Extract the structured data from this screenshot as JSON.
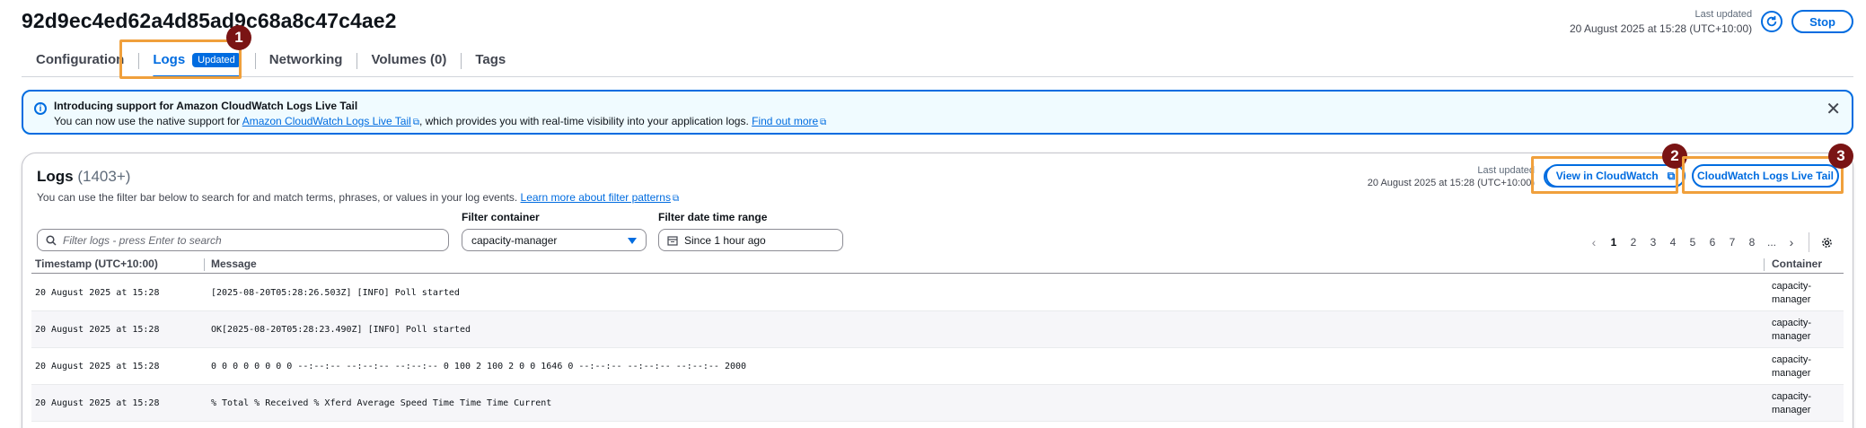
{
  "header": {
    "task_id": "92d9ec4ed62a4d85ad9c68a8c47c4ae2",
    "last_updated_label": "Last updated",
    "last_updated_value": "20 August 2025 at 15:28 (UTC+10:00)",
    "stop_label": "Stop"
  },
  "tabs": [
    {
      "label": "Configuration"
    },
    {
      "label": "Logs",
      "badge": "Updated"
    },
    {
      "label": "Networking"
    },
    {
      "label": "Volumes (0)"
    },
    {
      "label": "Tags"
    }
  ],
  "banner": {
    "title": "Introducing support for Amazon CloudWatch Logs Live Tail",
    "text_before": "You can now use the native support for ",
    "link1": "Amazon CloudWatch Logs Live Tail",
    "text_middle": ", which provides you with real-time visibility into your application logs. ",
    "link2": "Find out more"
  },
  "logs": {
    "title": "Logs",
    "count": "(1403+)",
    "description": "You can use the filter bar below to search for and match terms, phrases, or values in your log events. ",
    "learn_more": "Learn more about filter patterns",
    "last_updated_label": "Last updated",
    "last_updated_value": "20 August 2025 at 15:28 (UTC+10:00)",
    "view_in_cloudwatch": "View in CloudWatch",
    "live_tail": "CloudWatch Logs Live Tail",
    "filter_placeholder": "Filter logs - press Enter to search",
    "filter_container_label": "Filter container",
    "filter_container_value": "capacity-manager",
    "filter_date_label": "Filter date time range",
    "filter_date_value": "Since 1 hour ago",
    "pages": [
      "1",
      "2",
      "3",
      "4",
      "5",
      "6",
      "7",
      "8",
      "..."
    ],
    "columns": {
      "timestamp": "Timestamp (UTC+10:00)",
      "message": "Message",
      "container": "Container"
    },
    "rows": [
      {
        "timestamp": "20 August 2025 at 15:28",
        "message": "[2025-08-20T05:28:26.503Z] [INFO] Poll started",
        "container": "capacity-manager"
      },
      {
        "timestamp": "20 August 2025 at 15:28",
        "message": "OK[2025-08-20T05:28:23.490Z] [INFO] Poll started",
        "container": "capacity-manager"
      },
      {
        "timestamp": "20 August 2025 at 15:28",
        "message": "0 0 0 0 0 0 0 0 --:--:-- --:--:-- --:--:-- 0 100 2 100 2 0 0 1646 0 --:--:-- --:--:-- --:--:-- 2000",
        "container": "capacity-manager"
      },
      {
        "timestamp": "20 August 2025 at 15:28",
        "message": "% Total % Received % Xferd Average Speed Time Time Time Current",
        "container": "capacity-manager"
      }
    ]
  },
  "annotations": [
    "1",
    "2",
    "3"
  ],
  "colors": {
    "accent": "#006ce0",
    "highlight": "#f0a03c",
    "annotation": "#7a1414"
  }
}
